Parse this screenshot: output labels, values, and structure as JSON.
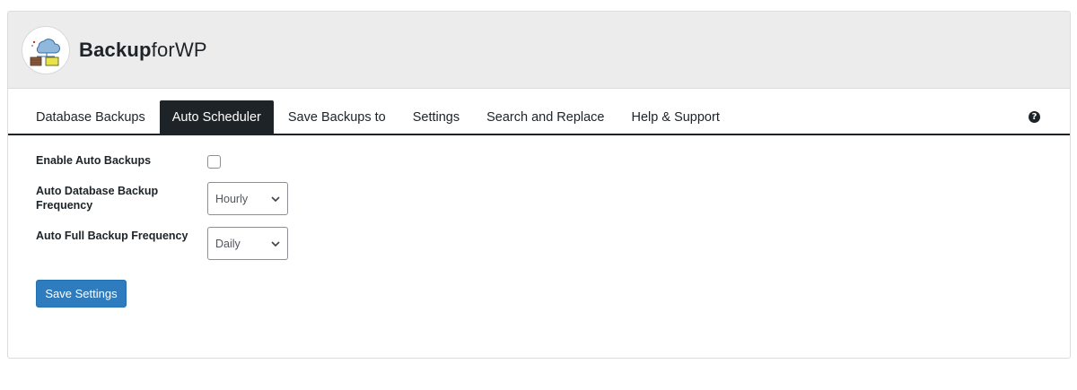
{
  "brand": {
    "bold": "Backup",
    "light": "forWP"
  },
  "tabs": [
    {
      "label": "Database Backups",
      "active": false
    },
    {
      "label": "Auto Scheduler",
      "active": true
    },
    {
      "label": "Save Backups to",
      "active": false
    },
    {
      "label": "Settings",
      "active": false
    },
    {
      "label": "Search and Replace",
      "active": false
    },
    {
      "label": "Help & Support",
      "active": false
    }
  ],
  "help_icon": "question-circle-icon",
  "form": {
    "enable_auto_backups": {
      "label": "Enable Auto Backups",
      "checked": false
    },
    "db_frequency": {
      "label": "Auto Database Backup Frequency",
      "value": "Hourly"
    },
    "full_frequency": {
      "label": "Auto Full Backup Frequency",
      "value": "Daily"
    },
    "save_button": "Save Settings"
  },
  "colors": {
    "accent": "#2e7bbd",
    "tab_active_bg": "#1d2327",
    "header_bg": "#ececec"
  }
}
